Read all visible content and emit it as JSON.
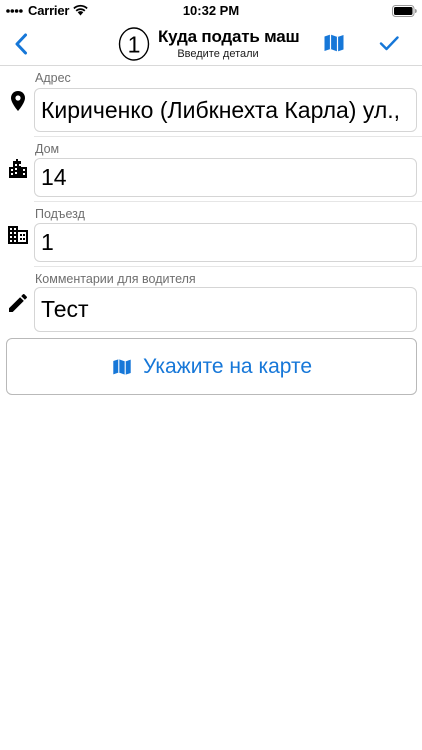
{
  "status_bar": {
    "carrier": "Carrier",
    "time": "10:32 PM"
  },
  "nav": {
    "step_number": "1",
    "title": "Куда подать маш",
    "subtitle": "Введите детали",
    "back_icon": "chevron-left-icon",
    "map_icon": "map-icon",
    "confirm_icon": "checkmark-icon"
  },
  "form": {
    "address": {
      "label": "Адрес",
      "value": "Кириченко (Либкнехта Карла) ул.,",
      "icon": "location-pin-icon"
    },
    "house": {
      "label": "Дом",
      "value": "14",
      "icon": "city-buildings-icon"
    },
    "entrance": {
      "label": "Подъезд",
      "value": "1",
      "icon": "building-icon"
    },
    "comment": {
      "label": "Комментарии для водителя",
      "value": "Тест",
      "icon": "pencil-icon"
    }
  },
  "map_button": {
    "label": "Укажите на карте",
    "icon": "map-icon"
  },
  "colors": {
    "accent": "#1677d8",
    "label": "#6f6f6f",
    "border": "#d5d5d5"
  }
}
